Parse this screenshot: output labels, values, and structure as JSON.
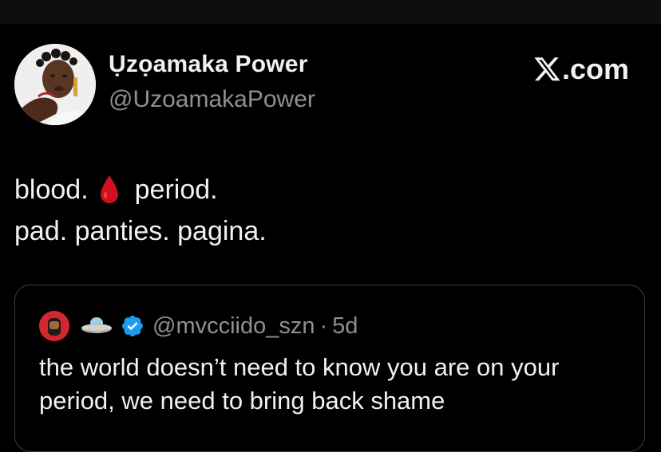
{
  "author": {
    "display_name": "Ụzọamaka Power",
    "handle": "@UzoamakaPower"
  },
  "brand": {
    "label": ".com"
  },
  "tweet": {
    "line1_a": "blood.",
    "line1_b": "period.",
    "line2": "pad. panties. pagina."
  },
  "quote": {
    "handle": "@mvcciido_szn",
    "separator": "·",
    "time": "5d",
    "text": "the world doesn’t need to know you are on your period, we need to bring back shame"
  },
  "icons": {
    "drop": "blood-drop-icon",
    "x_logo": "x-logo-icon",
    "ufo": "flying-saucer-icon",
    "verified": "verified-badge-icon"
  },
  "colors": {
    "background": "#000000",
    "text_primary": "#f1f1f1",
    "text_secondary": "#8b9096",
    "verified_blue": "#1d9bf0",
    "drop_red": "#d0101a",
    "card_border": "#3a3d41"
  }
}
